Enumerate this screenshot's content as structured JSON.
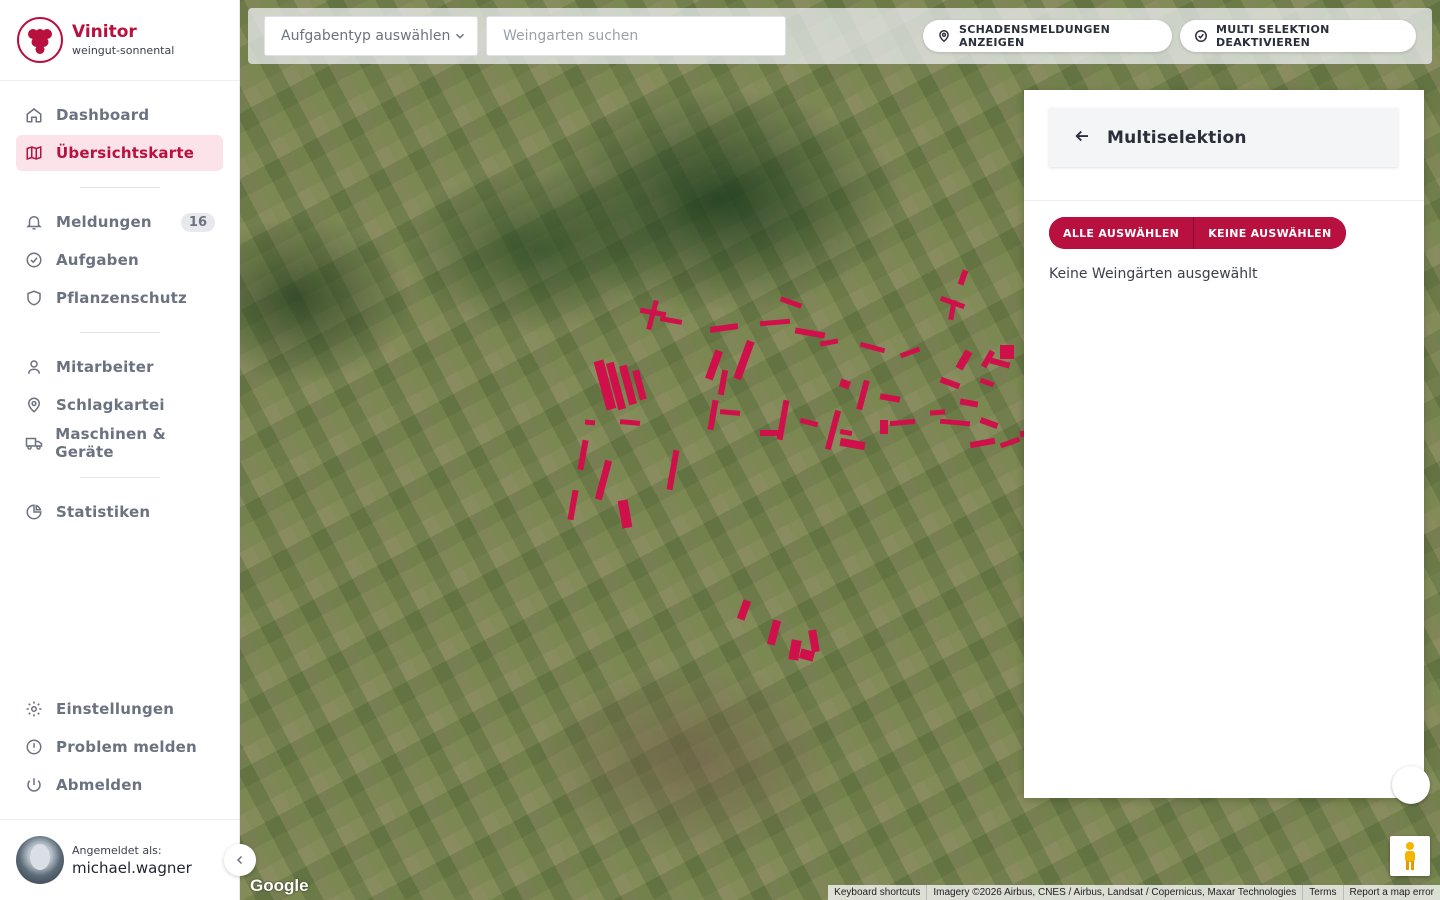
{
  "brand": {
    "name": "Vinitor",
    "subtitle": "weingut-sonnental"
  },
  "nav": {
    "main": [
      {
        "label": "Dashboard",
        "icon": "home-icon",
        "active": false
      },
      {
        "label": "Übersichtskarte",
        "icon": "map-icon",
        "active": true
      }
    ],
    "group2": [
      {
        "label": "Meldungen",
        "icon": "bell-icon",
        "badge": "16"
      },
      {
        "label": "Aufgaben",
        "icon": "check-circle-icon"
      },
      {
        "label": "Pflanzenschutz",
        "icon": "shield-icon"
      }
    ],
    "group3": [
      {
        "label": "Mitarbeiter",
        "icon": "user-icon"
      },
      {
        "label": "Schlagkartei",
        "icon": "location-pin-icon"
      },
      {
        "label": "Maschinen & Geräte",
        "icon": "truck-icon"
      }
    ],
    "group4": [
      {
        "label": "Statistiken",
        "icon": "pie-chart-icon"
      }
    ],
    "bottom": [
      {
        "label": "Einstellungen",
        "icon": "gear-icon"
      },
      {
        "label": "Problem melden",
        "icon": "alert-circle-icon"
      },
      {
        "label": "Abmelden",
        "icon": "power-icon"
      }
    ]
  },
  "user": {
    "label": "Angemeldet als:",
    "name": "michael.wagner"
  },
  "toolbar": {
    "task_type_placeholder": "Aufgabentyp auswählen",
    "search_placeholder": "Weingarten suchen",
    "damage_reports_label": "SCHADENSMELDUNGEN ANZEIGEN",
    "multi_select_label": "MULTI SELEKTION DEAKTIVIEREN"
  },
  "panel": {
    "title": "Multiselektion",
    "select_all_label": "ALLE AUSWÄHLEN",
    "select_none_label": "KEINE AUSWÄHLEN",
    "empty_text": "Keine Weingärten ausgewählt"
  },
  "map": {
    "provider_logo": "Google",
    "attribution": [
      "Keyboard shortcuts",
      "Imagery ©2026 Airbus, CNES / Airbus, Landsat / Copernicus, Maxar Technologies",
      "Terms",
      "Report a map error"
    ],
    "vineyard_color": "#d0104a"
  },
  "colors": {
    "accent": "#b8103f",
    "active_bg": "#fbe3e9"
  }
}
